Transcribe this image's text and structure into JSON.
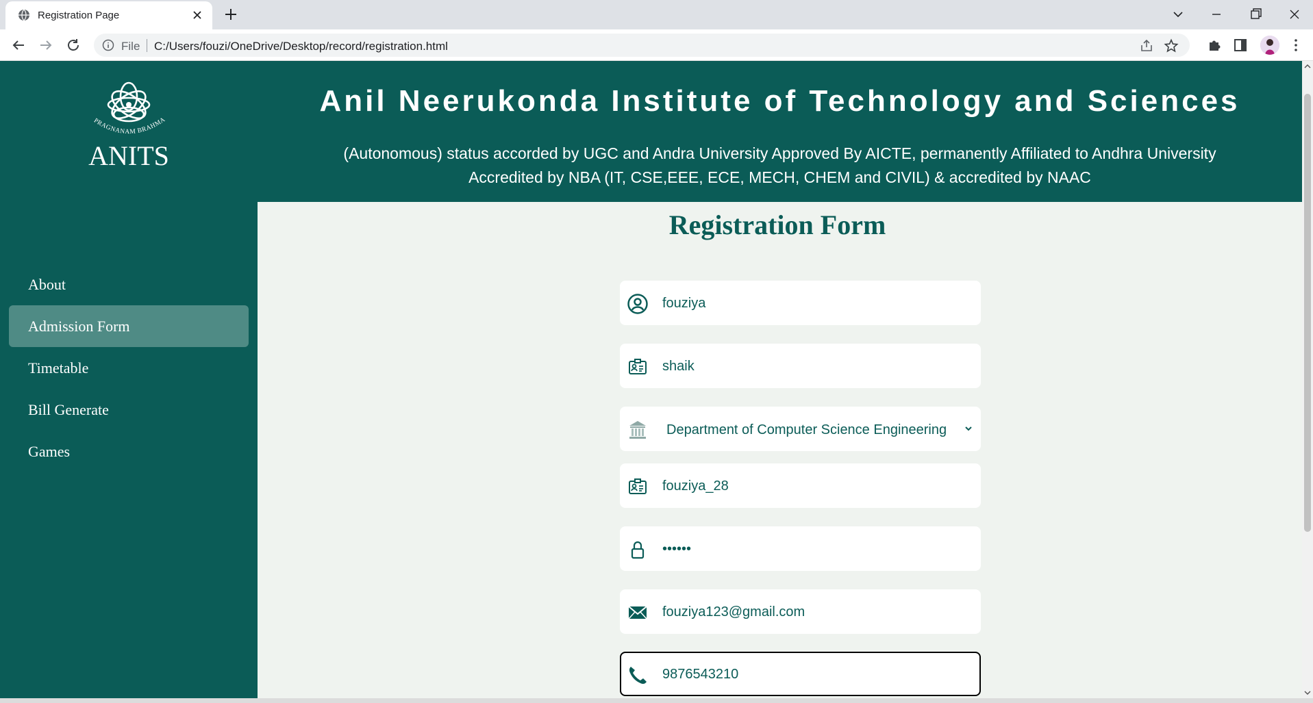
{
  "browser": {
    "tab_title": "Registration Page",
    "omnibox_scheme": "File",
    "url": "C:/Users/fouzi/OneDrive/Desktop/record/registration.html"
  },
  "header": {
    "logo_text": "ANITS",
    "logo_motto": "PRAGNANAM BRAHMA",
    "title": "Anil Neerukonda Institute of Technology and Sciences",
    "subtitle_line1": "(Autonomous) status accorded by UGC and Andra University Approved By AICTE, permanently Affiliated to Andhra University",
    "subtitle_line2": "Accredited by NBA (IT, CSE,EEE, ECE, MECH, CHEM and CIVIL) & accredited by NAAC"
  },
  "sidebar": {
    "items": [
      {
        "label": "About",
        "active": false
      },
      {
        "label": "Admission Form",
        "active": true
      },
      {
        "label": "Timetable",
        "active": false
      },
      {
        "label": "Bill Generate",
        "active": false
      },
      {
        "label": "Games",
        "active": false
      }
    ]
  },
  "form": {
    "title": "Registration Form",
    "first_name": "fouziya",
    "last_name": "shaik",
    "department": "Department of Computer Science Engineering",
    "username": "fouziya_28",
    "password_mask": "••••••",
    "email": "fouziya123@gmail.com",
    "phone": "9876543210"
  },
  "colors": {
    "brand": "#0b5c57",
    "sidebar_active": "#4f8b85",
    "page_bg": "#eff3ef"
  }
}
